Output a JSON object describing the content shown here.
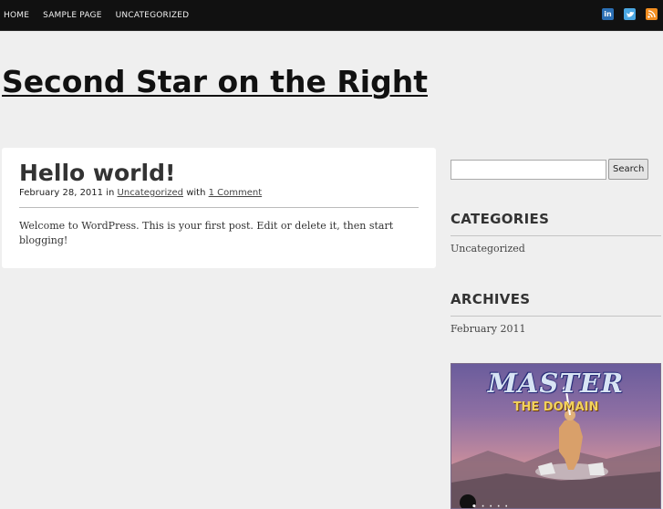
{
  "nav": {
    "items": [
      "HOME",
      "SAMPLE PAGE",
      "UNCATEGORIZED"
    ]
  },
  "social": {
    "linkedin": "in",
    "colors": {
      "linkedin": "#2b6fb4",
      "twitter": "#4aa6e0",
      "rss": "#f28e20"
    }
  },
  "site": {
    "title": "Second Star on the Right"
  },
  "post": {
    "title": "Hello world!",
    "date": "February 28, 2011",
    "in_word": "in",
    "category": "Uncategorized",
    "with_word": "with",
    "comments": "1 Comment",
    "body": "Welcome to WordPress. This is your first post. Edit or delete it, then start blogging!"
  },
  "sidebar": {
    "search_button": "Search",
    "search_value": "",
    "categories_title": "CATEGORIES",
    "categories": [
      "Uncategorized"
    ],
    "archives_title": "ARCHIVES",
    "archives": [
      "February 2011"
    ],
    "banner": {
      "line1": "MASTER",
      "line2": "THE DOMAIN",
      "bottom": "•  ·  ·  ·  ·"
    }
  }
}
